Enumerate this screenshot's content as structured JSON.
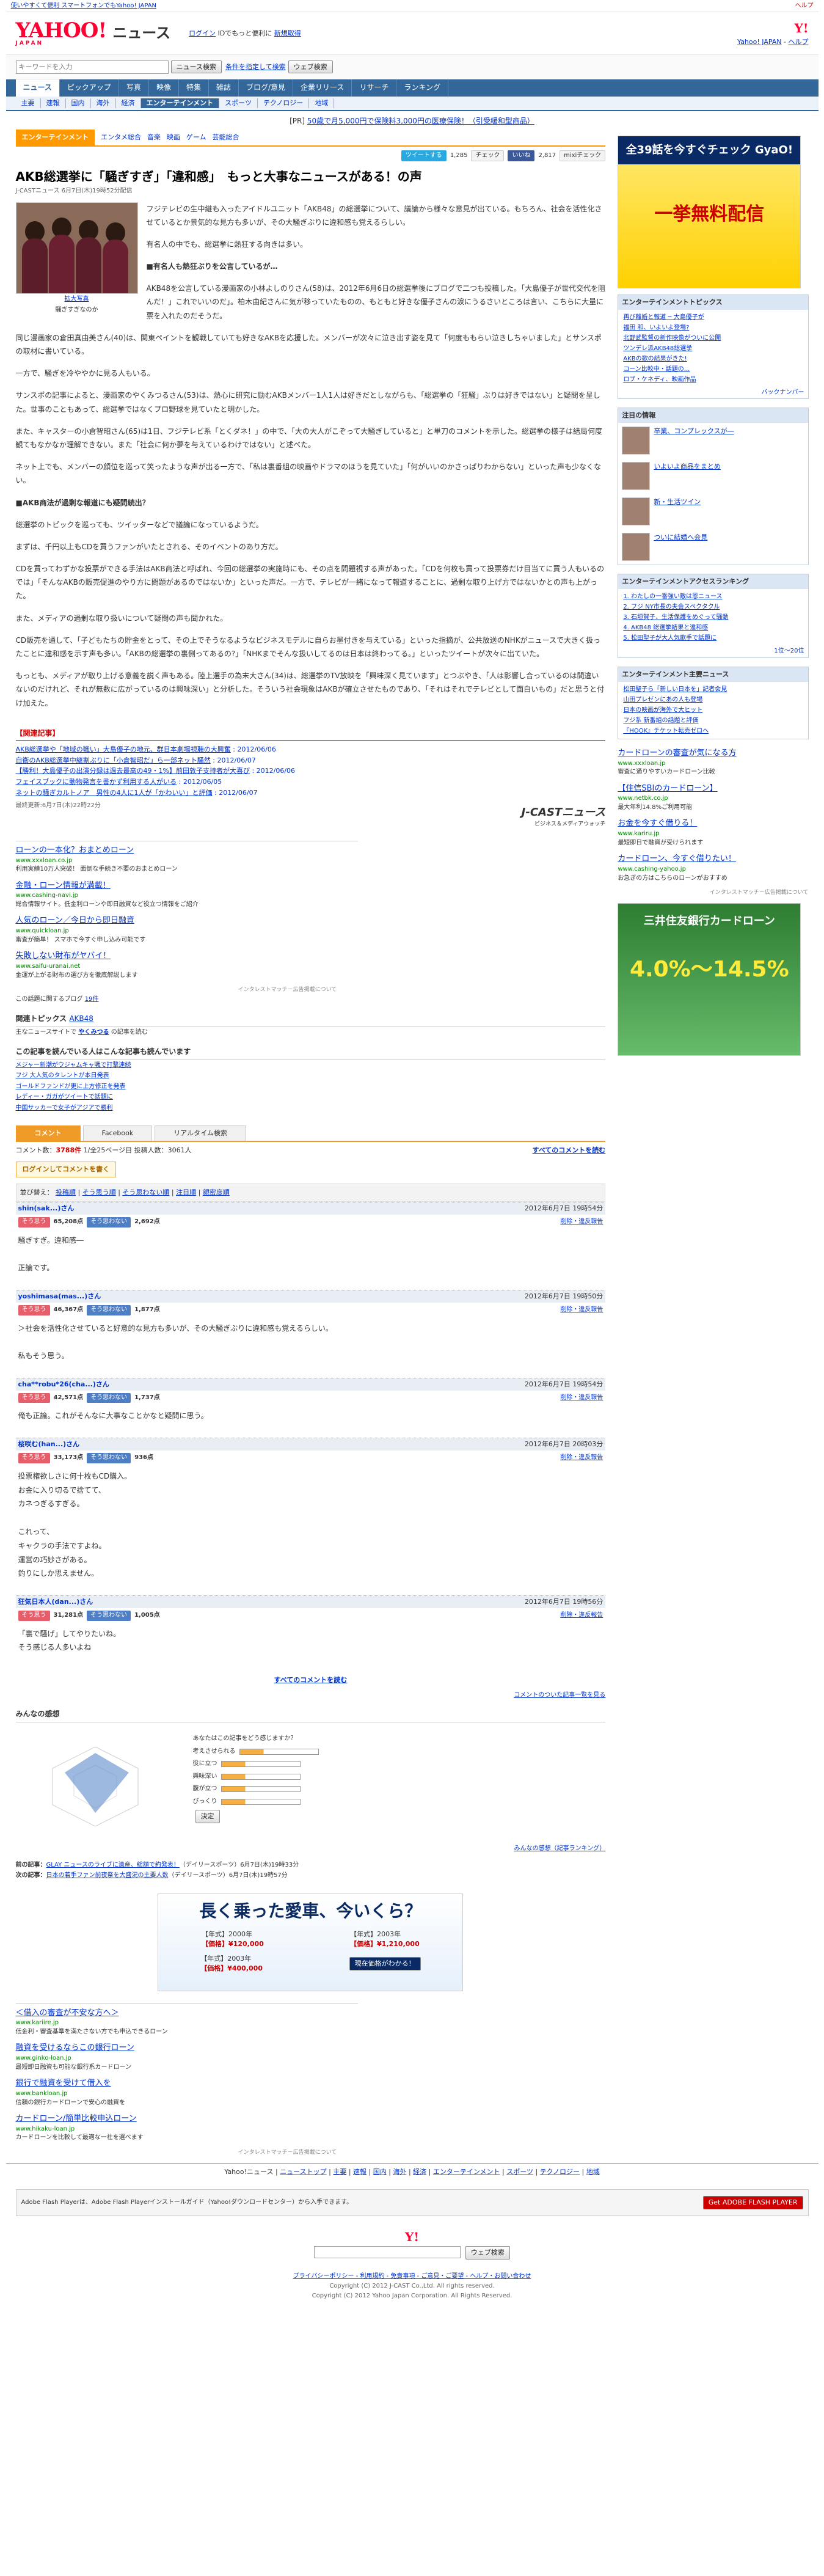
{
  "topbar": {
    "left": "使いやすくて便利 スマートフォンでもYahoo! JAPAN",
    "right": "ヘルプ"
  },
  "header": {
    "logo": "YAHOO!",
    "logo_sub": "JAPAN",
    "service": "ニュース",
    "login": "ログイン",
    "login_note": "IDでもっと便利に",
    "register": "新規取得",
    "yj_link": "Yahoo! JAPAN",
    "help": "ヘルプ"
  },
  "search": {
    "placeholder": "キーワードを入力",
    "btn_news": "ニュース検索",
    "btn_cond": "条件を指定して検索",
    "btn_web": "ウェブ検索"
  },
  "nav1": [
    "ニュース",
    "ピックアップ",
    "写真",
    "映像",
    "特集",
    "雑誌",
    "ブログ/意見",
    "企業リリース",
    "リサーチ",
    "ランキング"
  ],
  "nav2": [
    "主要",
    "速報",
    "国内",
    "海外",
    "経済",
    "エンターテインメント",
    "スポーツ",
    "テクノロジー",
    "地域"
  ],
  "pr": {
    "tag": "[PR]",
    "text": "50歳で月5,000円で保険料3,000円の医療保険！（引受緩和型商品）"
  },
  "category": {
    "label": "エンターテインメント",
    "tags": [
      "エンタメ総合",
      "音楽",
      "映画",
      "ゲーム",
      "芸能総合"
    ]
  },
  "share": {
    "tweet": "ツイートする",
    "count1": "1,285",
    "check": "チェック",
    "like": "いいね",
    "count2": "2,817",
    "mixi": "mixiチェック"
  },
  "article": {
    "title": "AKB総選挙に「騒ぎすぎ」「違和感」　もっと大事なニュースがある！の声",
    "source": "J-CASTニュース 6月7日(木)19時52分配信",
    "caption": "拡大写真",
    "caption2": "騒ぎすぎなのか",
    "paras": [
      "フジテレビの生中継も入ったアイドルユニット「AKB48」の総選挙について、議論から様々な意見が出ている。もちろん、社会を活性化させているとか景気的な見方も多いが、その大騒ぎぶりに違和感も覚えるらしい。",
      "有名人の中でも、総選挙に熱狂する向きは多い。",
      "■有名人も熱狂ぶりを公言しているが…",
      "AKB48を公言している漫画家の小林よしのりさん(58)は、2012年6月6日の総選挙後にブログで二つも投稿した。「大島優子が世代交代を阻んだ！」これでいいのだ」。柏木由紀さんに気が移っていたものの、もともと好きな優子さんの涙にうるさいところは言い、こちらに大量に票を入れたのだそうだ。",
      "同じ漫画家の倉田真由美さん(40)は、関東ペイントを観戦していても好きなAKBを応援した。メンバーが次々に泣き出す姿を見て「何度ももらい泣きしちゃいました」とサンスポの取材に書いている。",
      "一方で、騒ぎを冷ややかに見る人もいる。",
      "サンスポの記事によると、漫画家のやくみつるさん(53)は、熱心に研究に励むAKBメンバー1人1人は好きだとしながらも、「総選挙の「狂騒」ぶりは好きではない」と疑問を呈した。世事のこともあって、総選挙ではなくプロ野球を見ていたと明かした。",
      "また、キャスターの小倉智昭さん(65)は1日、フジテレビ系「とくダネ！」の中で、「大の大人がこぞって大騒ぎしていると」と単刀のコメントを示した。総選挙の様子は結局何度観てもなかなか理解できない。また「社会に何か夢を与えているわけではない」と述べた。",
      "ネット上でも、メンバーの顔位を巡って笑ったような声が出る一方で、「私は裏番組の映画やドラマのほうを見ていた」「何がいいのかさっぱりわからない」といった声も少なくない。",
      "■AKB商法が過剰な報道にも疑問続出？",
      "総選挙のトピックを巡っても、ツイッターなどで議論になっているようだ。",
      "まずは、千円以上もCDを買うファンがいたとされる、そのイベントのあり方だ。",
      "CDを買ってわずかな投票ができる手法はAKB商法と呼ばれ、今回の総選挙の実施時にも、その点を問題視する声があった。「CDを何枚も買って投票券だけ目当てに買う人もいるのでは」「そんなAKBの販売促進のやり方に問題があるのではないか」といった声だ。一方で、テレビが一緒になって報道することに、過剰な取り上げ方ではないかとの声も上がった。",
      "また、メディアの過剰な取り扱いについて疑問の声も聞かれた。",
      "CD販売を通して、「子どもたちの貯金をとって、その上でそうなるようなビジネスモデルに自らお墨付きを与えている」といった指摘が、公共放送のNHKがニュースで大きく扱ったことに違和感を示す声も多い。「AKBの総選挙の裏側ってあるの?」「NHKまでそんな扱いしてるのは日本は終わってる。」といったツイートが次々に出ていた。",
      "もっとも、メディアが取り上げる意義を説く声もある。陸上選手の為末大さん(34)は、総選挙のTV放映を「興味深く見ています」とつぶやき、「人は影響し合っているのは間違いないのだけれど、それが無数に広がっているのは興味深い」と分析した。そういう社会現象はAKBが確立させたものであり、「それはそれでテレビとして面白いもの」だと思うと付け加えた。"
    ],
    "related_title": "【関連記事】",
    "related": [
      {
        "t": "AKB総選挙や「地域の戦い」大島優子の地元、群日本劇場視聴の大興奮",
        "d": "2012/06/06"
      },
      {
        "t": "自衛のAKB総選挙中継割ぶりに「小倉智昭だ」ら一部ネット騒然",
        "d": "2012/06/07"
      },
      {
        "t": "【勝利！大島優子の出演分録は過去最高の49・1%】前田敦子支持者が大喜び",
        "d": "2012/06/06"
      },
      {
        "t": "フェイスブックに動物発言を書かず利用する人がいる",
        "d": "2012/06/05"
      },
      {
        "t": "ネットの騒ぎカルトノア　男性の4人に1人が「かわいい」と評価",
        "d": "2012/06/07"
      }
    ],
    "updated": "最終更新:6月7日(木)22時22分",
    "jcast": "J-CASTニュース",
    "jcast_sub": "ビジネス＆メディアウォッチ"
  },
  "ads": [
    {
      "t": "ローンの一本化？おまとめローン",
      "g": "www.xxxloan.co.jp",
      "x": "利用実績10万人突破！ 面倒な手続き不要のおまとめローン"
    },
    {
      "t": "金融・ローン情報が満載！",
      "g": "www.cashing-navi.jp",
      "x": "総合情報サイト。低金利ローンや即日融資など役立つ情報をご紹介"
    },
    {
      "t": "人気のローン／今日から即日融資",
      "g": "www.quickloan.jp",
      "x": "審査が簡単！ スマホで今すぐ申し込み可能です"
    },
    {
      "t": "失敗しない財布がヤバイ！",
      "g": "www.saifu-uranai.net",
      "x": "金運が上がる財布の選び方を徹底解説します"
    }
  ],
  "ads_note": "インタレストマッチ－広告掲載について",
  "rel_blog": {
    "label": "この話題に関するブログ",
    "count": "19件"
  },
  "rel_topic": {
    "label": "関連トピックス",
    "value": "AKB48"
  },
  "rel_by": {
    "label": "主なニュースサイトで",
    "name": "やくみつる",
    "suffix": "の記事を読む"
  },
  "others": {
    "title": "この記事を読んでいる人はこんな記事も読んでいます",
    "items": [
      "メジャー新潮がウジャムキャ戦で打撃連続",
      "フジ 大人気のタレントが本日発表",
      "ゴールドファンドが更に上方修正を発表",
      "レディー・ガガがツイートで話題に",
      "中国サッカーで女子がアジアで勝利"
    ]
  },
  "comments": {
    "tabs": [
      "コメント",
      "Facebook",
      "リアルタイム検索"
    ],
    "count_label": "コメント数",
    "count": "3788件",
    "pages": "1",
    "pages_total": "/全25ページ目",
    "voters": "投稿人数：3061人",
    "read_all": "すべてのコメントを読む",
    "post": "ログインしてコメントを書く",
    "sort_label": "並び替え",
    "sort": [
      "投稿順",
      "そう思う順",
      "そう思わない順",
      "注目順",
      "親密度順"
    ],
    "items": [
      {
        "user": "shin(sak...)さん",
        "date": "2012年6月7日 19時54分",
        "agree": "65,208点",
        "disagree": "2,692点",
        "text": "騒ぎすぎ。違和感―\n\n正論です。"
      },
      {
        "user": "yoshimasa(mas...)さん",
        "date": "2012年6月7日 19時50分",
        "agree": "46,367点",
        "disagree": "1,877点",
        "text": "＞社会を活性化させていると好意的な見方も多いが、その大騒ぎぶりに違和感も覚えるらしい。\n\n私もそう思う。"
      },
      {
        "user": "cha**robu*26(cha...)さん",
        "date": "2012年6月7日 19時54分",
        "agree": "42,571点",
        "disagree": "1,737点",
        "text": "俺も正論。これがそんなに大事なことかなと疑問に思う。"
      },
      {
        "user": "桜咲む(han...)さん",
        "date": "2012年6月7日 20時03分",
        "agree": "33,173点",
        "disagree": "936点",
        "text": "投票権欲しさに何十枚もCD購入。\nお金に入り切るで捨てて、\nカネつぎるすぎる。\n\nこれって、\nキャクラの手法ですよね。\n運営の巧妙さがある。\n釣りにしか思えません。"
      },
      {
        "user": "狂気日本人(dan...)さん",
        "date": "2012年6月7日 19時56分",
        "agree": "31,281点",
        "disagree": "1,005点",
        "text": "「裏で騒げ」してやりたいね。\nそう感じる人多いよね"
      }
    ],
    "read_all2": "すべてのコメントを読む",
    "guideline": "コメントのついた記事一覧を見る",
    "report": "削除・違反報告",
    "agree_label": "そう思う",
    "disagree_label": "そう思わない"
  },
  "feelings": {
    "title": "みんなの感想",
    "question": "あなたはこの記事をどう感じますか？",
    "axes": [
      "考えさせられる",
      "役に立つ",
      "興味深い",
      "腹が立つ",
      "ひどい",
      "びっくり"
    ],
    "rows": [
      "考えさせられる",
      "役に立つ",
      "興味深い",
      "腹が立つ",
      "びっくり"
    ],
    "scale": [
      "1",
      "2",
      "3",
      "4",
      "5"
    ],
    "submit": "決定",
    "ranking": "みんなの感想（記事ランキング）"
  },
  "prev_next": [
    {
      "k": "前の記事：",
      "t": "GLAY ニュースのライブに遺産、総額で約発表！",
      "s": "（デイリースポーツ）6月7日(木)19時33分"
    },
    {
      "k": "次の記事：",
      "t": "日本の若手ファン前夜祭を大盛況の主要人数",
      "s": "（デイリースポーツ）6月7日(木)19時57分"
    }
  ],
  "car_ad": {
    "title": "長く乗った愛車、今いくら？",
    "c1": "【年式】2000年",
    "c2": "【年式】2003年",
    "p1": "【価格】¥120,000",
    "p2": "【価格】¥1,210,000",
    "c3": "【年式】2003年",
    "p3": "【価格】¥400,000",
    "btn": "現在価格がわかる！"
  },
  "ads2": [
    {
      "t": "＜借入の審査が不安な方へ＞",
      "g": "www.kariire.jp",
      "x": "低金利・審査基準を満たさない方でも申込できるローン"
    },
    {
      "t": "融資を受けるならこの銀行ローン",
      "g": "www.ginko-loan.jp",
      "x": "最短即日融資も可能な銀行系カードローン"
    },
    {
      "t": "銀行で融資を受けて借入を",
      "g": "www.bankloan.jp",
      "x": "信頼の銀行カードローンで安心の融資を"
    },
    {
      "t": "カードローン/簡単比較申込ローン",
      "g": "www.hikaku-loan.jp",
      "x": "カードローンを比較して最適な一社を選べます"
    }
  ],
  "bottom_nav": [
    "Yahoo!ニュース",
    "ニューストップ",
    "主要",
    "速報",
    "国内",
    "海外",
    "経済",
    "エンターテインメント",
    "スポーツ",
    "テクノロジー",
    "地域"
  ],
  "flash": {
    "text": "Adobe Flash Playerは、Adobe Flash Playerインストールガイド（Yahoo!ダウンロードセンター）から入手できます。",
    "btn": "Get ADOBE FLASH PLAYER"
  },
  "footer": {
    "links": "プライバシーポリシー - 利用規約 - 免責事項 - ご意見・ご要望 - ヘルプ・お問い合わせ",
    "c1": "Copyright (C) 2012 J-CAST Co.,Ltd. All rights reserved.",
    "c2": "Copyright (C) 2012 Yahoo Japan Corporation. All Rights Reserved."
  },
  "side": {
    "ad1_t1": "全39話を今すぐチェック GyaO!",
    "ad1_t2": "一挙無料配信",
    "ent_topics_title": "エンターテインメントトピックス",
    "ent_topics": [
      "再び離婚と報道 ─ 大島優子が",
      "福田 和、いよいよ登場?",
      "北野武監督の新作映像がついに公開",
      "ツンデレ派AKB48総選挙",
      "AKBの歌の結果がきた!",
      "コーン比較中・話題の...",
      "ロブ・ケネディ、映画作品"
    ],
    "ent_more": "バックナンバー",
    "chuumoku": "注目の情報",
    "chuumoku_items": [
      "卒業、コンプレックスが―",
      "いよいよ商品をまとめ",
      "新・生活ツイン",
      "ついに結婚へ会見"
    ],
    "ranking_title": "エンターテインメントアクセスランキング",
    "ranking": [
      "1. わたしの一番強い敵は恩ニュース",
      "2. フジ NY市長の夫会スペクタクル",
      "3. 石垣賀子、生活保護をめぐって騒動",
      "4. AKB48 総選挙結果と違和感",
      "5. 松田聖子が大人気歌手で話題に"
    ],
    "rank_more": "1位～20位",
    "ent_news_title": "エンターテインメント主要ニュース",
    "ent_news": [
      "松田聖子ら「新しい日本を」記者会見",
      "山田プレゼンにあの人も登場",
      "日本の映画が海外で大ヒット",
      "フジ系 新番組の話題と評価",
      "『HOOK』チケット転売ゼロへ"
    ],
    "ads": [
      {
        "t": "カードローンの審査が気になる方",
        "g": "www.xxxloan.jp",
        "x": "審査に通りやすいカードローン比較"
      },
      {
        "t": "【住信SBIのカードローン】",
        "g": "www.netbk.co.jp",
        "x": "最大年利14.8%ご利用可能"
      },
      {
        "t": "お金を今すぐ借りる！",
        "g": "www.kariru.jp",
        "x": "最短即日で融資が受けられます"
      },
      {
        "t": "カードローン、今すぐ借りたい！",
        "g": "www.cashing-yahoo.jp",
        "x": "お急ぎの方はこちらのローンがおすすめ"
      }
    ],
    "ad2_t": "三井住友銀行カードローン",
    "ad2_n": "4.0%～14.5%"
  }
}
